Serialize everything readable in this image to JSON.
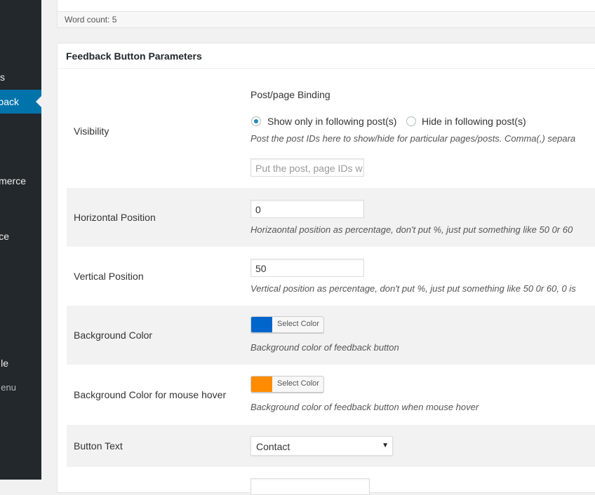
{
  "sidebar": {
    "items": [
      {
        "label": "s"
      },
      {
        "label": "back"
      },
      {
        "label": "merce"
      },
      {
        "label": "ce"
      },
      {
        "label": "le"
      },
      {
        "label": "enu"
      }
    ]
  },
  "wordcount": {
    "label": "Word count: 5"
  },
  "panel": {
    "title": "Feedback Button Parameters",
    "visibility": {
      "label": "Visibility",
      "binding_title": "Post/page Binding",
      "option_show": "Show only in following post(s)",
      "option_hide": "Hide in following post(s)",
      "selected": "show",
      "description": "Post the post IDs here to show/hide for particular pages/posts. Comma(,) separa",
      "ids_placeholder": "Put the post, page IDs w"
    },
    "horizontal": {
      "label": "Horizontal Position",
      "value": "0",
      "description": "Horizaontal position as percentage, don't put %, just put something like 50 0r 60"
    },
    "vertical": {
      "label": "Vertical Position",
      "value": "50",
      "description": "Vertical position as percentage, don't put %, just put something like 50 0r 60, 0 is"
    },
    "bg_color": {
      "label": "Background Color",
      "button_label": "Select Color",
      "color": "#0066cc",
      "description": "Background color of feedback button"
    },
    "bg_hover": {
      "label": "Background Color for mouse hover",
      "button_label": "Select Color",
      "color": "#ff8c00",
      "description": "Background color of feedback button when mouse hover"
    },
    "button_text": {
      "label": "Button Text",
      "selected": "Contact"
    }
  },
  "colors": {
    "sidebar_bg": "#23282d",
    "active_menu": "#0073aa",
    "radio_dot": "#1e8cbe"
  }
}
